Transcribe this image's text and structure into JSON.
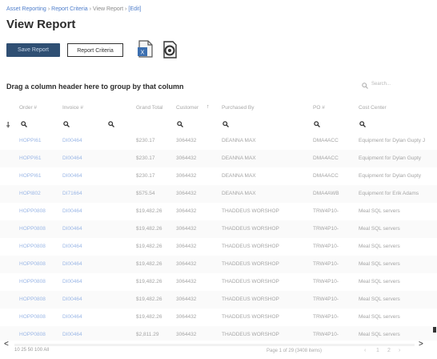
{
  "breadcrumb": {
    "part1": "Asset Reporting",
    "part2": "Report Criteria",
    "part3": "View Report",
    "part4": "[Edit]"
  },
  "page_title": "View Report",
  "toolbar": {
    "save_report_label": "Save Report",
    "report_criteria_label": "Report Criteria",
    "excel_icon": "excel-export-icon",
    "other_icon": "settings-export-icon"
  },
  "grid": {
    "group_hint": "Drag a column header here to group by that column",
    "search_placeholder": "Search...",
    "columns": [
      "Order #",
      "Invoice #",
      "Grand Total",
      "Customer",
      "Purchased By",
      "PO #",
      "Cost Center"
    ],
    "rows": [
      {
        "order": "HOPPI61",
        "invoice": "DI00464",
        "total": "$230.17",
        "customer": "3064432",
        "purchased_by": "DEANNA MAX",
        "po": "DMA4ACC",
        "cost_center": "Equipment for Dylan Gupty J"
      },
      {
        "order": "HOPPI61",
        "invoice": "DI00464",
        "total": "$230.17",
        "customer": "3064432",
        "purchased_by": "DEANNA MAX",
        "po": "DMA4ACC",
        "cost_center": "Equipment for Dylan Gupty"
      },
      {
        "order": "HOPPI61",
        "invoice": "DI00464",
        "total": "$230.17",
        "customer": "3064432",
        "purchased_by": "DEANNA MAX",
        "po": "DMA4ACC",
        "cost_center": "Equipment for Dylan Gupty"
      },
      {
        "order": "HOPI802",
        "invoice": "DI71664",
        "total": "$575.54",
        "customer": "3064432",
        "purchased_by": "DEANNA MAX",
        "po": "DMA4AWB",
        "cost_center": "Equipment for Erik Adams"
      },
      {
        "order": "HOPP0808",
        "invoice": "DI00464",
        "total": "$19,482.26",
        "customer": "3064432",
        "purchased_by": "THADDEUS WORSHOP",
        "po": "TRW4P10-",
        "cost_center": "Meal SQL servers"
      },
      {
        "order": "HOPP0808",
        "invoice": "DI00464",
        "total": "$19,482.26",
        "customer": "3064432",
        "purchased_by": "THADDEUS WORSHOP",
        "po": "TRW4P10-",
        "cost_center": "Meal SQL servers"
      },
      {
        "order": "HOPP0808",
        "invoice": "DI00464",
        "total": "$19,482.26",
        "customer": "3064432",
        "purchased_by": "THADDEUS WORSHOP",
        "po": "TRW4P10-",
        "cost_center": "Meal SQL servers"
      },
      {
        "order": "HOPP0808",
        "invoice": "DI00464",
        "total": "$19,482.26",
        "customer": "3064432",
        "purchased_by": "THADDEUS WORSHOP",
        "po": "TRW4P10-",
        "cost_center": "Meal SQL servers"
      },
      {
        "order": "HOPP0808",
        "invoice": "DI00464",
        "total": "$19,482.26",
        "customer": "3064432",
        "purchased_by": "THADDEUS WORSHOP",
        "po": "TRW4P10-",
        "cost_center": "Meal SQL servers"
      },
      {
        "order": "HOPP0808",
        "invoice": "DI00464",
        "total": "$19,482.26",
        "customer": "3064432",
        "purchased_by": "THADDEUS WORSHOP",
        "po": "TRW4P10-",
        "cost_center": "Meal SQL servers"
      },
      {
        "order": "HOPP0808",
        "invoice": "DI00464",
        "total": "$19,482.26",
        "customer": "3064432",
        "purchased_by": "THADDEUS WORSHOP",
        "po": "TRW4P10-",
        "cost_center": "Meal SQL servers"
      },
      {
        "order": "HOPP0808",
        "invoice": "DI00464",
        "total": "$19,482.26",
        "customer": "3064432",
        "purchased_by": "THADDEUS WORSHOP",
        "po": "TRW4P10-",
        "cost_center": "Meal SQL servers"
      },
      {
        "order": "HOPP0808",
        "invoice": "DI00464",
        "total": "$2,811.29",
        "customer": "3064432",
        "purchased_by": "THADDEUS WORSHOP",
        "po": "TRW4P10-",
        "cost_center": "Meal SQL servers"
      }
    ]
  },
  "footer": {
    "page_sizes": "10   25   50   100   All",
    "page_info": "Page 1 of 29 (3408 items)",
    "prev": "<",
    "next": ">"
  },
  "colors": {
    "primary_button": "#2f4f73",
    "link": "#9bb7e6",
    "title": "#2c2c2c"
  }
}
